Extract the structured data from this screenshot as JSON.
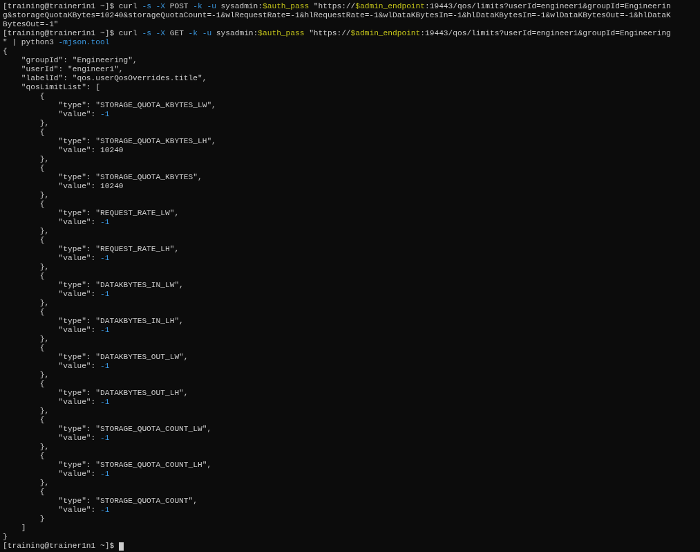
{
  "terminal": {
    "lines": [
      [
        {
          "text": "[training@trainer1n1 ~]$ curl ",
          "kind": "plain"
        },
        {
          "text": "-s -X",
          "kind": "flag"
        },
        {
          "text": " POST ",
          "kind": "plain"
        },
        {
          "text": "-k -u",
          "kind": "flag"
        },
        {
          "text": " sysadmin:",
          "kind": "plain"
        },
        {
          "text": "$auth_pass",
          "kind": "var"
        },
        {
          "text": " \"https://",
          "kind": "plain"
        },
        {
          "text": "$admin_endpoint",
          "kind": "var"
        },
        {
          "text": ":19443/qos/limits?userId=engineer1&groupId=Engineerin",
          "kind": "plain"
        }
      ],
      "g&storageQuotaKBytes=10240&storageQuotaCount=-1&wlRequestRate=-1&hlRequestRate=-1&wlDataKBytesIn=-1&hlDataKBytesIn=-1&wlDataKBytesOut=-1&hlDataK",
      "BytesOut=-1\"",
      [
        {
          "text": "[training@trainer1n1 ~]$ curl ",
          "kind": "plain"
        },
        {
          "text": "-s -X",
          "kind": "flag"
        },
        {
          "text": " GET ",
          "kind": "plain"
        },
        {
          "text": "-k -u",
          "kind": "flag"
        },
        {
          "text": " sysadmin:",
          "kind": "plain"
        },
        {
          "text": "$auth_pass",
          "kind": "var"
        },
        {
          "text": " \"https://",
          "kind": "plain"
        },
        {
          "text": "$admin_endpoint",
          "kind": "var"
        },
        {
          "text": ":19443/qos/limits?userId=engineer1&groupId=Engineering",
          "kind": "plain"
        }
      ],
      [
        {
          "text": "\" | python3 ",
          "kind": "plain"
        },
        {
          "text": "-mjson.tool",
          "kind": "flag"
        }
      ],
      "{",
      "    \"groupId\": \"Engineering\",",
      "    \"userId\": \"engineer1\",",
      "    \"labelId\": \"qos.userQosOverrides.title\",",
      "    \"qosLimitList\": [",
      "        {",
      "            \"type\": \"STORAGE_QUOTA_KBYTES_LW\",",
      [
        {
          "text": "            \"value\": ",
          "kind": "plain"
        },
        {
          "text": "-1",
          "kind": "number"
        }
      ],
      "        },",
      "        {",
      "            \"type\": \"STORAGE_QUOTA_KBYTES_LH\",",
      "            \"value\": 10240",
      "        },",
      "        {",
      "            \"type\": \"STORAGE_QUOTA_KBYTES\",",
      "            \"value\": 10240",
      "        },",
      "        {",
      "            \"type\": \"REQUEST_RATE_LW\",",
      [
        {
          "text": "            \"value\": ",
          "kind": "plain"
        },
        {
          "text": "-1",
          "kind": "number"
        }
      ],
      "        },",
      "        {",
      "            \"type\": \"REQUEST_RATE_LH\",",
      [
        {
          "text": "            \"value\": ",
          "kind": "plain"
        },
        {
          "text": "-1",
          "kind": "number"
        }
      ],
      "        },",
      "        {",
      "            \"type\": \"DATAKBYTES_IN_LW\",",
      [
        {
          "text": "            \"value\": ",
          "kind": "plain"
        },
        {
          "text": "-1",
          "kind": "number"
        }
      ],
      "        },",
      "        {",
      "            \"type\": \"DATAKBYTES_IN_LH\",",
      [
        {
          "text": "            \"value\": ",
          "kind": "plain"
        },
        {
          "text": "-1",
          "kind": "number"
        }
      ],
      "        },",
      "        {",
      "            \"type\": \"DATAKBYTES_OUT_LW\",",
      [
        {
          "text": "            \"value\": ",
          "kind": "plain"
        },
        {
          "text": "-1",
          "kind": "number"
        }
      ],
      "        },",
      "        {",
      "            \"type\": \"DATAKBYTES_OUT_LH\",",
      [
        {
          "text": "            \"value\": ",
          "kind": "plain"
        },
        {
          "text": "-1",
          "kind": "number"
        }
      ],
      "        },",
      "        {",
      "            \"type\": \"STORAGE_QUOTA_COUNT_LW\",",
      [
        {
          "text": "            \"value\": ",
          "kind": "plain"
        },
        {
          "text": "-1",
          "kind": "number"
        }
      ],
      "        },",
      "        {",
      "            \"type\": \"STORAGE_QUOTA_COUNT_LH\",",
      [
        {
          "text": "            \"value\": ",
          "kind": "plain"
        },
        {
          "text": "-1",
          "kind": "number"
        }
      ],
      "        },",
      "        {",
      "            \"type\": \"STORAGE_QUOTA_COUNT\",",
      [
        {
          "text": "            \"value\": ",
          "kind": "plain"
        },
        {
          "text": "-1",
          "kind": "number"
        }
      ],
      "        }",
      "    ]",
      "}"
    ],
    "prompt": "[training@trainer1n1 ~]$ ",
    "cursor_visible": true
  }
}
